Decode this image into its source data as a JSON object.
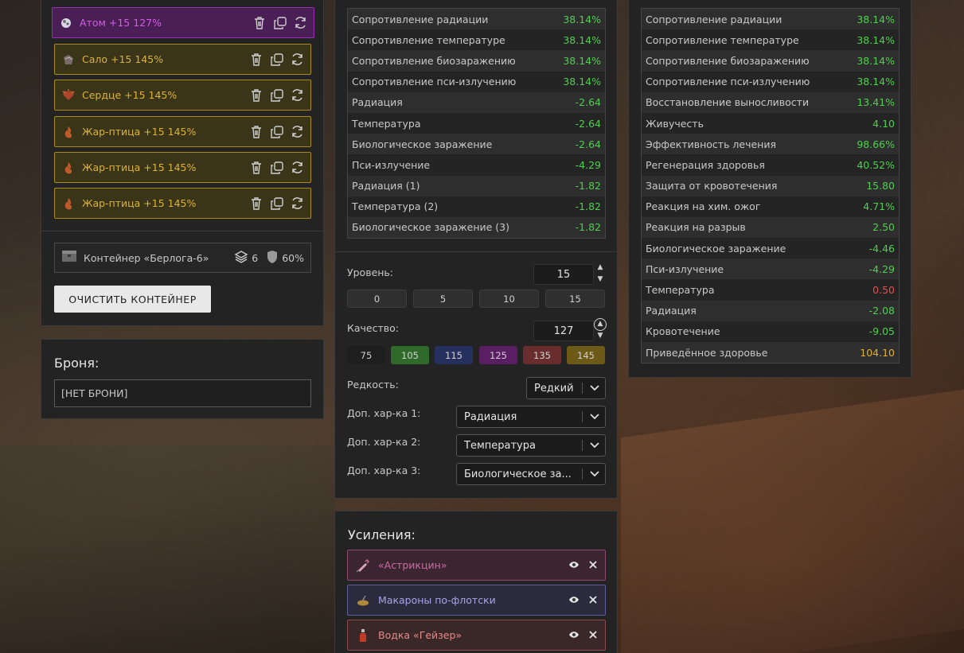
{
  "colors": {
    "accent_yellow": "#d9b33a",
    "accent_purple": "#d65ae6",
    "value_green": "#4fcf4f",
    "value_red": "#e05050",
    "value_gold": "#e0b030"
  },
  "artifacts": [
    {
      "label": "Атом +15 127%",
      "rarity": "purple",
      "icon": "atom-icon"
    },
    {
      "label": "Сало +15 145%",
      "rarity": "yellow",
      "icon": "salo-icon"
    },
    {
      "label": "Сердце +15 145%",
      "rarity": "yellow",
      "icon": "heart-artifact-icon"
    },
    {
      "label": "Жар-птица +15 145%",
      "rarity": "yellow",
      "icon": "firebird-icon"
    },
    {
      "label": "Жар-птица +15 145%",
      "rarity": "yellow",
      "icon": "firebird-icon"
    },
    {
      "label": "Жар-птица +15 145%",
      "rarity": "yellow",
      "icon": "firebird-icon"
    }
  ],
  "container": {
    "label": "Контейнер «Берлога-6»",
    "slots": "6",
    "protection": "60%",
    "clear_button": "ОЧИСТИТЬ КОНТЕЙНЕР"
  },
  "armor": {
    "title": "Броня:",
    "value": "[НЕТ БРОНИ]"
  },
  "artifact_stats": [
    {
      "name": "Сопротивление радиации",
      "value": "38.14%",
      "tone": "green"
    },
    {
      "name": "Сопротивление температуре",
      "value": "38.14%",
      "tone": "green"
    },
    {
      "name": "Сопротивление биозаражению",
      "value": "38.14%",
      "tone": "green"
    },
    {
      "name": "Сопротивление пси-излучению",
      "value": "38.14%",
      "tone": "green"
    },
    {
      "name": "Радиация",
      "value": "-2.64",
      "tone": "green"
    },
    {
      "name": "Температура",
      "value": "-2.64",
      "tone": "green"
    },
    {
      "name": "Биологическое заражение",
      "value": "-2.64",
      "tone": "green"
    },
    {
      "name": "Пси-излучение",
      "value": "-4.29",
      "tone": "green"
    },
    {
      "name": "Радиация (1)",
      "value": "-1.82",
      "tone": "green"
    },
    {
      "name": "Температура (2)",
      "value": "-1.82",
      "tone": "green"
    },
    {
      "name": "Биологическое заражение (3)",
      "value": "-1.82",
      "tone": "green"
    }
  ],
  "editor": {
    "level_label": "Уровень:",
    "level_value": "15",
    "level_presets": [
      "0",
      "5",
      "10",
      "15"
    ],
    "quality_label": "Качество:",
    "quality_value": "127",
    "quality_presets": [
      {
        "label": "75",
        "color": "#1e1e1e"
      },
      {
        "label": "105",
        "color": "#2f6a2a"
      },
      {
        "label": "115",
        "color": "#26305e"
      },
      {
        "label": "125",
        "color": "#5a1f62"
      },
      {
        "label": "135",
        "color": "#6a2d2d"
      },
      {
        "label": "145",
        "color": "#6d5a17"
      }
    ],
    "rarity_label": "Редкость:",
    "rarity_value": "Редкий",
    "extra1_label": "Доп. хар-ка 1:",
    "extra1_value": "Радиация",
    "extra2_label": "Доп. хар-ка 2:",
    "extra2_value": "Температура",
    "extra3_label": "Доп. хар-ка 3:",
    "extra3_value": "Биологическое за..."
  },
  "boosts": {
    "title": "Усиления:",
    "items": [
      {
        "label": "«Астрикцин»",
        "text_color": "#cf6aa5",
        "bg": "#3a2530",
        "border": "#8a4a6e",
        "icon": "syringe-icon"
      },
      {
        "label": "Макароны по-флотски",
        "text_color": "#a7a4e6",
        "bg": "#2c2b3d",
        "border": "#5f5c99",
        "icon": "pasta-icon"
      },
      {
        "label": "Водка «Гейзер»",
        "text_color": "#e68a8a",
        "bg": "#3a2727",
        "border": "#8c4a4a",
        "icon": "vodka-icon"
      }
    ]
  },
  "summary_stats": [
    {
      "name": "Сопротивление радиации",
      "value": "38.14%",
      "tone": "green"
    },
    {
      "name": "Сопротивление температуре",
      "value": "38.14%",
      "tone": "green"
    },
    {
      "name": "Сопротивление биозаражению",
      "value": "38.14%",
      "tone": "green"
    },
    {
      "name": "Сопротивление пси-излучению",
      "value": "38.14%",
      "tone": "green"
    },
    {
      "name": "Восстановление выносливости",
      "value": "13.41%",
      "tone": "green"
    },
    {
      "name": "Живучесть",
      "value": "4.10",
      "tone": "green"
    },
    {
      "name": "Эффективность лечения",
      "value": "98.66%",
      "tone": "green"
    },
    {
      "name": "Регенерация здоровья",
      "value": "40.52%",
      "tone": "green"
    },
    {
      "name": "Защита от кровотечения",
      "value": "15.80",
      "tone": "green"
    },
    {
      "name": "Реакция на хим. ожог",
      "value": "4.71%",
      "tone": "green"
    },
    {
      "name": "Реакция на разрыв",
      "value": "2.50",
      "tone": "green"
    },
    {
      "name": "Биологическое заражение",
      "value": "-4.46",
      "tone": "green"
    },
    {
      "name": "Пси-излучение",
      "value": "-4.29",
      "tone": "green"
    },
    {
      "name": "Температура",
      "value": "0.50",
      "tone": "red"
    },
    {
      "name": "Радиация",
      "value": "-2.08",
      "tone": "green"
    },
    {
      "name": "Кровотечение",
      "value": "-9.05",
      "tone": "green"
    },
    {
      "name": "Приведённое здоровье",
      "value": "104.10",
      "tone": "gold"
    }
  ]
}
